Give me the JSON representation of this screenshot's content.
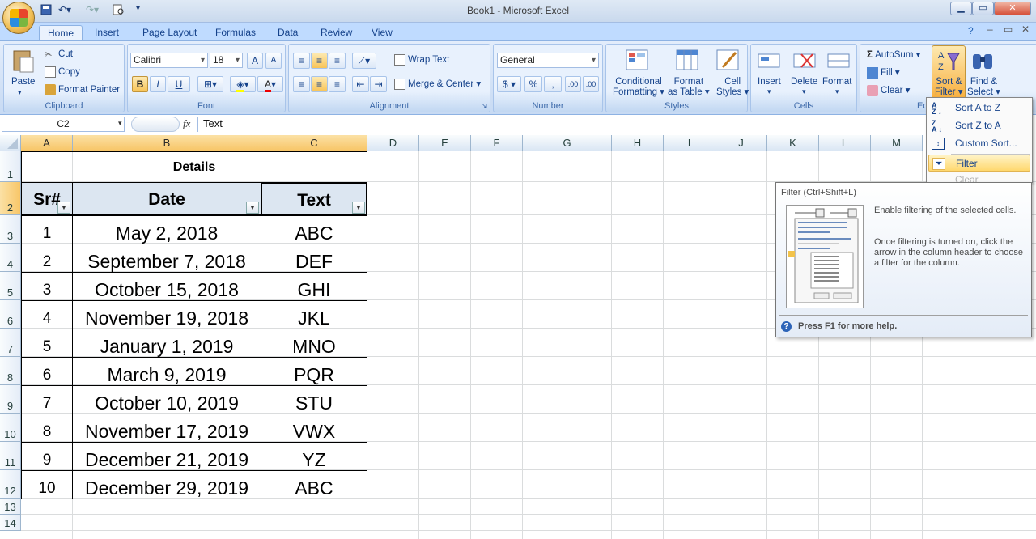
{
  "window": {
    "title": "Book1 - Microsoft Excel"
  },
  "tabs": [
    "Home",
    "Insert",
    "Page Layout",
    "Formulas",
    "Data",
    "Review",
    "View"
  ],
  "clipboard": {
    "paste": "Paste",
    "cut": "Cut",
    "copy": "Copy",
    "format_painter": "Format Painter",
    "label": "Clipboard"
  },
  "font": {
    "name": "Calibri",
    "size": "18",
    "bold": "B",
    "italic": "I",
    "underline": "U",
    "label": "Font"
  },
  "alignment": {
    "wrap_text": "Wrap Text",
    "merge_center": "Merge & Center",
    "label": "Alignment"
  },
  "number": {
    "format": "General",
    "currency": "$",
    "percent": "%",
    "comma": ",",
    "inc_decimal": ".00",
    "dec_decimal": ".00",
    "label": "Number"
  },
  "styles": {
    "conditional_l1": "Conditional",
    "conditional_l2": "Formatting",
    "format_table_l1": "Format",
    "format_table_l2": "as Table",
    "cell_styles_l1": "Cell",
    "cell_styles_l2": "Styles",
    "label": "Styles"
  },
  "cells": {
    "insert": "Insert",
    "delete": "Delete",
    "format": "Format",
    "label": "Cells"
  },
  "editing": {
    "autosum": "AutoSum",
    "fill": "Fill",
    "clear": "Clear",
    "sort_filter_l1": "Sort &",
    "sort_filter_l2": "Filter",
    "find_select_l1": "Find &",
    "find_select_l2": "Select",
    "label_partial": "Ed"
  },
  "formula_bar": {
    "name_box": "C2",
    "fx": "fx",
    "content": "Text"
  },
  "columns": [
    "A",
    "B",
    "C",
    "D",
    "E",
    "F",
    "G",
    "H",
    "I",
    "J",
    "K",
    "L",
    "M"
  ],
  "rows": [
    "1",
    "2",
    "3",
    "4",
    "5",
    "6",
    "7",
    "8",
    "9",
    "10",
    "11",
    "12",
    "13",
    "14"
  ],
  "sheet": {
    "title": "Details",
    "headers": [
      "Sr#",
      "Date",
      "Text"
    ],
    "records": [
      [
        "1",
        "May 2, 2018",
        "ABC"
      ],
      [
        "2",
        "September 7, 2018",
        "DEF"
      ],
      [
        "3",
        "October 15, 2018",
        "GHI"
      ],
      [
        "4",
        "November 19, 2018",
        "JKL"
      ],
      [
        "5",
        "January 1, 2019",
        "MNO"
      ],
      [
        "6",
        "March 9, 2019",
        "PQR"
      ],
      [
        "7",
        "October 10, 2019",
        "STU"
      ],
      [
        "8",
        "November 17, 2019",
        "VWX"
      ],
      [
        "9",
        "December 21, 2019",
        "YZ"
      ],
      [
        "10",
        "December 29, 2019",
        "ABC"
      ]
    ]
  },
  "sort_menu": {
    "sort_az": "Sort A to Z",
    "sort_za": "Sort Z to A",
    "custom_sort": "Custom Sort...",
    "filter": "Filter",
    "clear": "Clear"
  },
  "tooltip": {
    "title": "Filter (Ctrl+Shift+L)",
    "line1": "Enable filtering of the selected cells.",
    "line2": "Once filtering is turned on, click the arrow in the column header to choose a filter for the column.",
    "help": "Press F1 for more help."
  },
  "colors": {
    "selected_header": "#f8c668",
    "ribbon": "#c7daf3",
    "accent": "#15428b"
  }
}
